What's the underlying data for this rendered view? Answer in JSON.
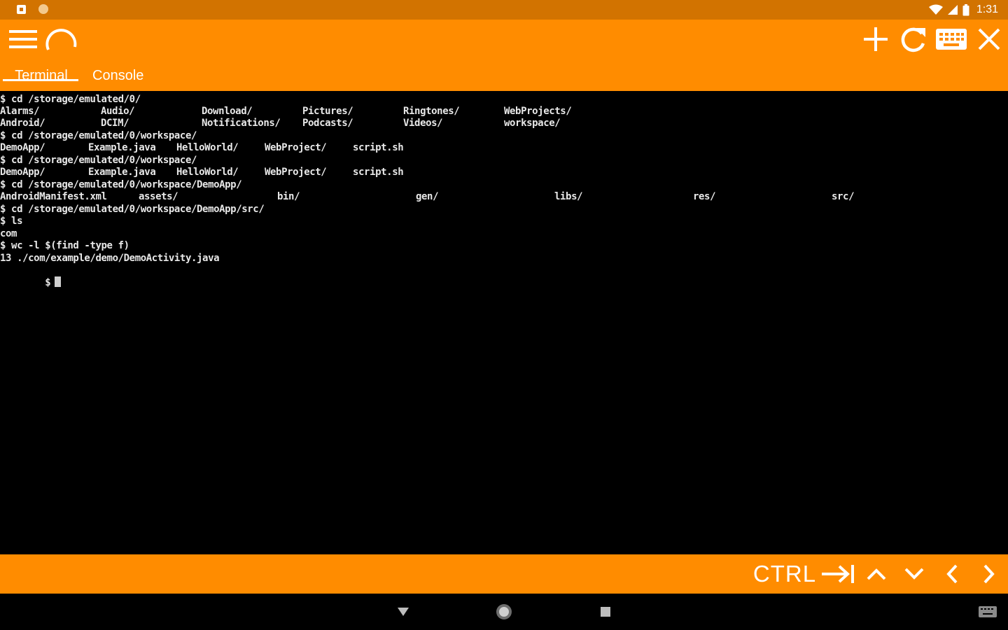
{
  "status_bar": {
    "time": "1:31",
    "notification_icons": [
      "android-notification-icon",
      "dot-notification-icon"
    ],
    "system_icons": [
      "wifi-icon",
      "signal-icon",
      "battery-icon"
    ]
  },
  "toolbar": {
    "left_icons": [
      "menu-icon",
      "loading-spinner-icon"
    ],
    "right_icons": [
      "add-icon",
      "refresh-icon",
      "keyboard-icon",
      "close-icon"
    ],
    "tabs": [
      {
        "label": "Terminal",
        "active": true
      },
      {
        "label": "Console",
        "active": false
      }
    ],
    "accent_color": "#ff8c00",
    "status_color": "#d27300"
  },
  "terminal": {
    "lines": [
      [
        "$ cd /storage/emulated/0/"
      ],
      [
        "Alarms/",
        "Audio/",
        "Download/",
        "Pictures/",
        "Ringtones/",
        "WebProjects/"
      ],
      [
        "Android/",
        "DCIM/",
        "Notifications/",
        "Podcasts/",
        "Videos/",
        "workspace/"
      ],
      [
        "$ cd /storage/emulated/0/workspace/"
      ],
      [
        "DemoApp/",
        "Example.java",
        "HelloWorld/",
        "WebProject/",
        "script.sh"
      ],
      [
        "$ cd /storage/emulated/0/workspace/"
      ],
      [
        "DemoApp/",
        "Example.java",
        "HelloWorld/",
        "WebProject/",
        "script.sh"
      ],
      [
        "$ cd /storage/emulated/0/workspace/DemoApp/"
      ],
      [
        "AndroidManifest.xml",
        "assets/",
        "bin/",
        "gen/",
        "libs/",
        "res/",
        "src/"
      ],
      [
        "$ cd /storage/emulated/0/workspace/DemoApp/src/"
      ],
      [
        "$ ls"
      ],
      [
        "com"
      ],
      [
        "$ wc -l $(find -type f)"
      ],
      [
        "13 ./com/example/demo/DemoActivity.java"
      ]
    ],
    "prompt": "$"
  },
  "extra_keys": {
    "ctrl_label": "CTRL",
    "keys": [
      "tab-key-icon",
      "arrow-up-icon",
      "arrow-down-icon",
      "arrow-left-icon",
      "arrow-right-icon"
    ]
  },
  "nav_bar": {
    "buttons": [
      "back-icon",
      "home-icon",
      "recents-icon",
      "keyboard-switch-icon"
    ]
  }
}
